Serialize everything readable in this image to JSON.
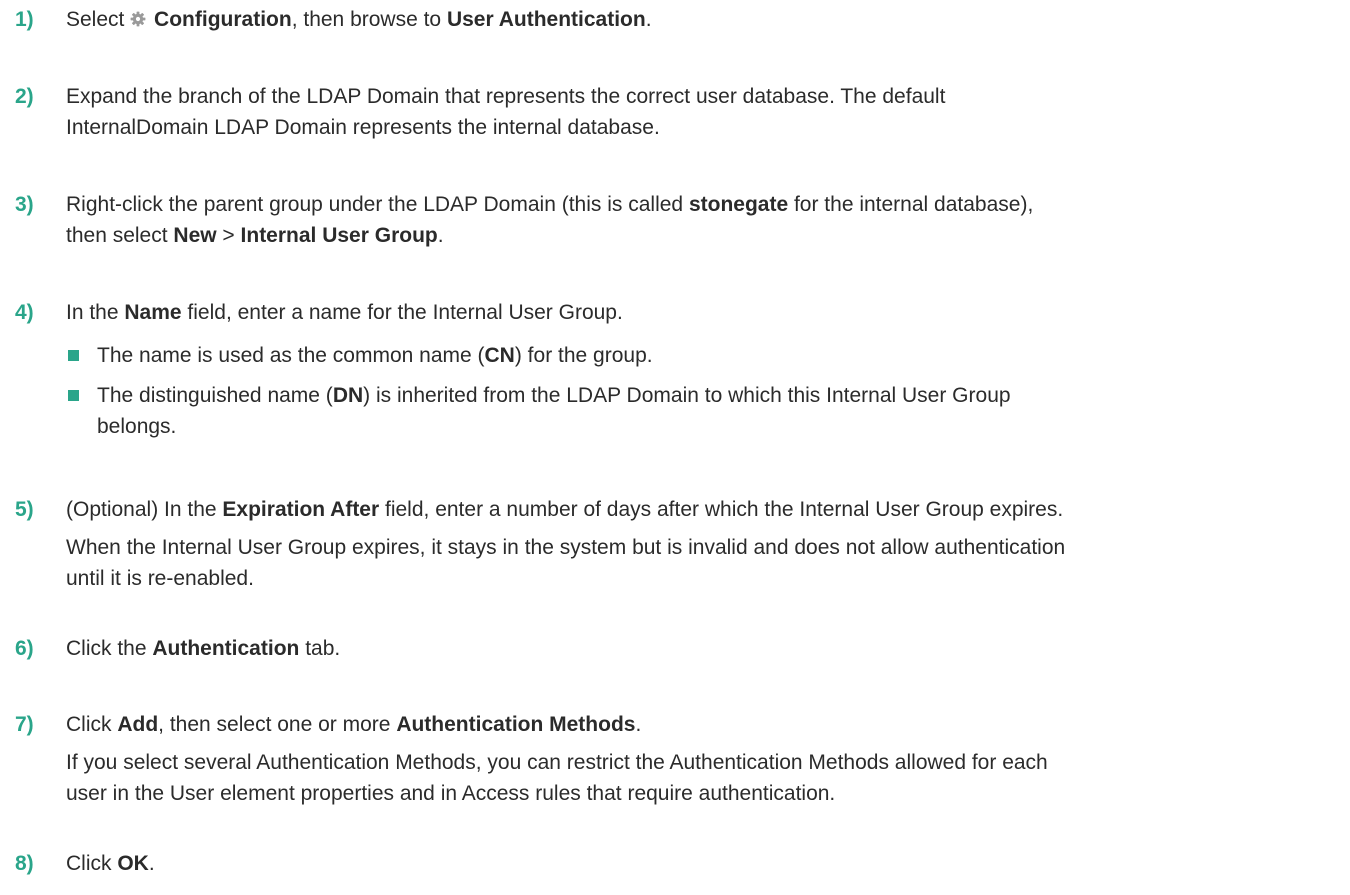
{
  "steps": [
    {
      "num": "1)",
      "parts": {
        "a": "Select ",
        "icon": "gear-icon",
        "b": "Configuration",
        "c": ", then browse to ",
        "d": "User Authentication",
        "e": "."
      }
    },
    {
      "num": "2)",
      "line1": "Expand the branch of the LDAP Domain that represents the correct user database. The default",
      "line2": "InternalDomain LDAP Domain represents the internal database."
    },
    {
      "num": "3)",
      "line1a": "Right-click the parent group under the LDAP Domain (this is called ",
      "line1b": "stonegate",
      "line1c": " for the internal database),",
      "line2a": "then select ",
      "line2b": "New",
      "line2c": " > ",
      "line2d": "Internal User Group",
      "line2e": "."
    },
    {
      "num": "4)",
      "a": "In the ",
      "b": "Name",
      "c": " field, enter a name for the Internal User Group.",
      "bullets": [
        {
          "a": "The name is used as the common name (",
          "b": "CN",
          "c": ") for the group."
        },
        {
          "a": "The distinguished name (",
          "b": "DN",
          "c": ") is inherited from the LDAP Domain to which this Internal User Group",
          "d": "belongs."
        }
      ]
    },
    {
      "num": "5)",
      "a": "(Optional) In the ",
      "b": "Expiration After",
      "c": " field, enter a number of days after which the Internal User Group expires.",
      "note1": "When the Internal User Group expires, it stays in the system but is invalid and does not allow authentication",
      "note2": "until it is re-enabled."
    },
    {
      "num": "6)",
      "a": "Click the ",
      "b": "Authentication",
      "c": " tab."
    },
    {
      "num": "7)",
      "a": "Click ",
      "b": "Add",
      "c": ", then select one or more ",
      "d": "Authentication Methods",
      "e": ".",
      "note1": "If you select several Authentication Methods, you can restrict the Authentication Methods allowed for each",
      "note2": "user in the User element properties and in Access rules that require authentication."
    },
    {
      "num": "8)",
      "a": "Click ",
      "b": "OK",
      "c": "."
    }
  ],
  "colors": {
    "accent": "#2aa58a",
    "text": "#2b2b2b",
    "icon": "#9a9a9a"
  }
}
